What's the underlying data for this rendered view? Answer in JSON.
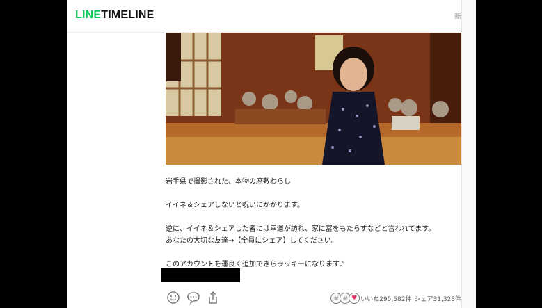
{
  "header": {
    "logo_line": "LINE",
    "logo_timeline": "TIMELINE",
    "right_text": "新"
  },
  "post": {
    "photo_icon": "photo-of-girl-in-tatami-room",
    "lines": [
      "岩手県で撮影された、本物の座敷わらし",
      "",
      "イイネ＆シェアしないと呪いにかかります。",
      "",
      "逆に、イイネ＆シェアした者には幸運が訪れ、家に富をもたらすなどと言われてます。",
      "あなたの大切な友達→【全員にシェア】してください。",
      "",
      "このアカウントを運良く追加できらラッキーになります♪"
    ]
  },
  "actions": {
    "smile_icon": "smile-icon",
    "comment_icon": "comment-icon",
    "share_icon": "share-icon",
    "likes": "いいね295,582件",
    "shares": "シェア31,328件"
  },
  "colors": {
    "brand": "#06c755",
    "background": "#000000"
  }
}
